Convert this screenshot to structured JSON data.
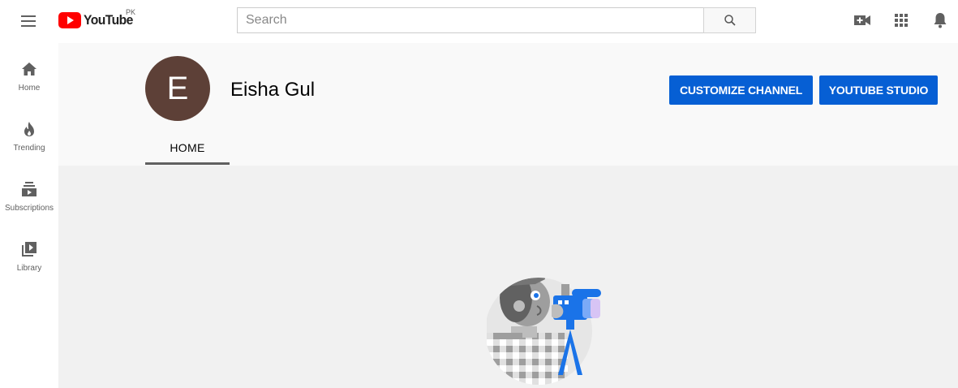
{
  "masthead": {
    "logo_text": "YouTube",
    "region": "PK",
    "search_placeholder": "Search",
    "search_value": ""
  },
  "guide": {
    "items": [
      {
        "label": "Home",
        "icon": "home-icon"
      },
      {
        "label": "Trending",
        "icon": "fire-icon"
      },
      {
        "label": "Subscriptions",
        "icon": "subscriptions-icon"
      },
      {
        "label": "Library",
        "icon": "library-icon"
      }
    ]
  },
  "channel": {
    "avatar_letter": "E",
    "avatar_color": "#5d4037",
    "name": "Eisha Gul",
    "customize_label": "CUSTOMIZE CHANNEL",
    "studio_label": "YOUTUBE STUDIO",
    "accent_color": "#065fd4"
  },
  "tabs": [
    {
      "label": "HOME",
      "selected": true
    }
  ]
}
